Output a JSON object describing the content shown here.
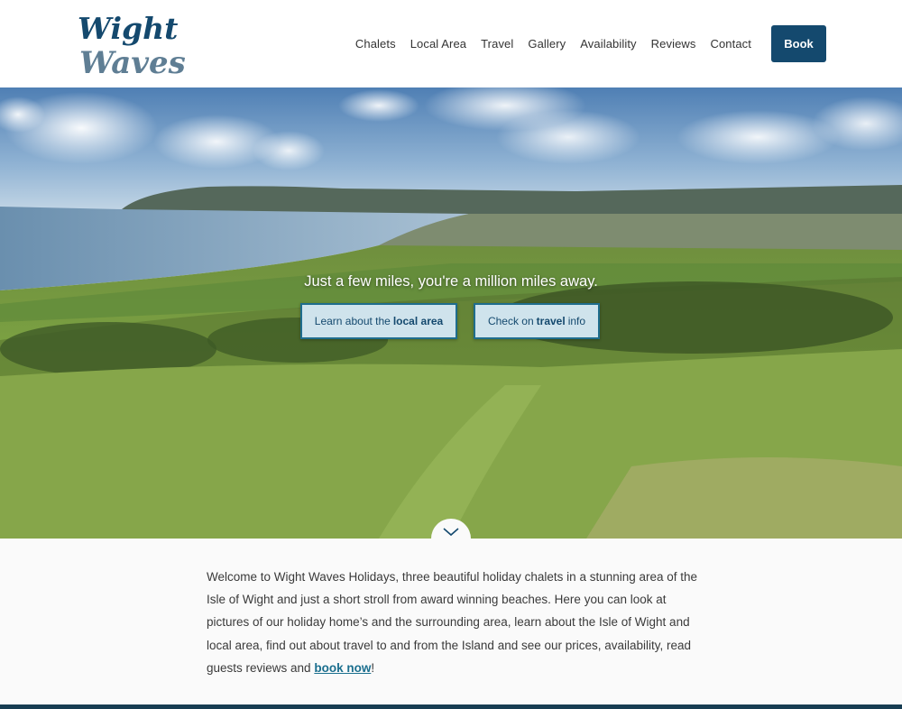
{
  "brand": {
    "logo_line1": "Wight",
    "logo_line2": "Waves",
    "color": "#14496e",
    "accent": "#5f7e94"
  },
  "nav": {
    "items": [
      "Chalets",
      "Local Area",
      "Travel",
      "Gallery",
      "Availability",
      "Reviews",
      "Contact"
    ],
    "book_label": "Book"
  },
  "hero": {
    "tagline": "Just a few miles, you're a million miles away.",
    "cta_local": {
      "before": "Learn about the",
      "bold": "local area",
      "after": ""
    },
    "cta_travel": {
      "before": "Check on",
      "bold": "travel",
      "after": "info"
    },
    "scroll_icon": "chevron-down-icon"
  },
  "intro": {
    "text": "Welcome to Wight Waves Holidays, three beautiful holiday chalets in a stunning area of the Isle of Wight and just a short stroll from award winning beaches.  Here you can look at pictures of our holiday home’s and the surrounding area, learn about the Isle of Wight and  local area, find out about travel to and from the Island and see our prices, availability, read guests reviews and",
    "link_text": "book now",
    "suffix": "!"
  }
}
